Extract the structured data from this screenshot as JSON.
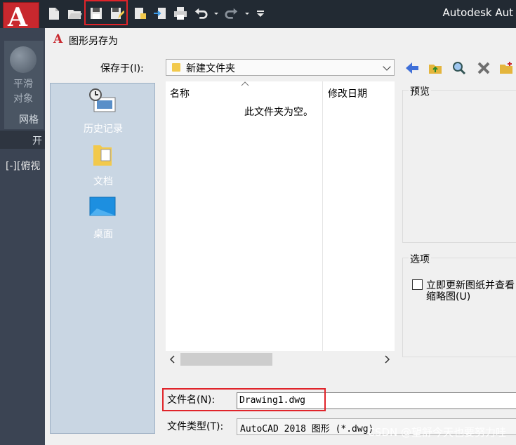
{
  "app": {
    "title": "Autodesk Aut",
    "logo_letter": "A"
  },
  "cad_side": {
    "smooth_label_1": "平滑",
    "smooth_label_2": "对象",
    "mesh_label": "网格",
    "tab_label": "开",
    "viewport_label": "[-][俯视"
  },
  "dialog": {
    "title": "图形另存为",
    "save_in_label": "保存于(I):",
    "save_in_value": "新建文件夹",
    "places": [
      {
        "label": "历史记录",
        "icon": "history-icon"
      },
      {
        "label": "文档",
        "icon": "documents-folder-icon"
      },
      {
        "label": "桌面",
        "icon": "desktop-icon"
      }
    ],
    "columns": {
      "name": "名称",
      "modified": "修改日期"
    },
    "empty_message": "此文件夹为空。",
    "preview_label": "预览",
    "options_label": "选项",
    "checkbox_label_1": "立即更新图纸并查看",
    "checkbox_label_2": "缩略图(U)",
    "filename_label": "文件名(N):",
    "filename_value": "Drawing1.dwg",
    "filetype_label": "文件类型(T):",
    "filetype_value": "AutoCAD 2018 图形 (*.dwg)"
  },
  "watermark": "CSDN @望舒今天也要努力哇",
  "colors": {
    "accent_red": "#e0242a",
    "autocad_red": "#c8282e"
  }
}
